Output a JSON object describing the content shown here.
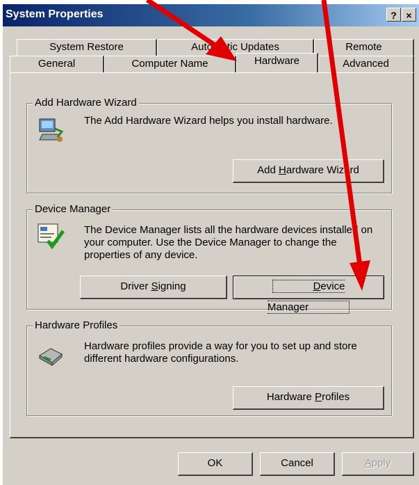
{
  "window": {
    "title": "System Properties",
    "help_label": "?",
    "close_label": "×"
  },
  "tabs_row1": [
    {
      "label": "System Restore"
    },
    {
      "label": "Automatic Updates"
    },
    {
      "label": "Remote"
    }
  ],
  "tabs_row2": [
    {
      "label": "General"
    },
    {
      "label": "Computer Name"
    },
    {
      "label": "Hardware"
    },
    {
      "label": "Advanced"
    }
  ],
  "add_hardware": {
    "group_label": "Add Hardware Wizard",
    "description": "The Add Hardware Wizard helps you install hardware.",
    "button_pre": "Add ",
    "button_ul": "H",
    "button_post": "ardware Wizard"
  },
  "device_manager": {
    "group_label": "Device Manager",
    "description": "The Device Manager lists all the hardware devices installed on your computer. Use the Device Manager to change the properties of any device.",
    "driver_pre": "Driver ",
    "driver_ul": "S",
    "driver_post": "igning",
    "dm_ul": "D",
    "dm_post": "evice Manager"
  },
  "hardware_profiles": {
    "group_label": "Hardware Profiles",
    "description": "Hardware profiles provide a way for you to set up and store different hardware configurations.",
    "button_pre": "Hardware ",
    "button_ul": "P",
    "button_post": "rofiles"
  },
  "footer": {
    "ok": "OK",
    "cancel": "Cancel",
    "apply_ul": "A",
    "apply_post": "pply"
  },
  "annotation": {
    "arrow_color": "#ff0000"
  }
}
